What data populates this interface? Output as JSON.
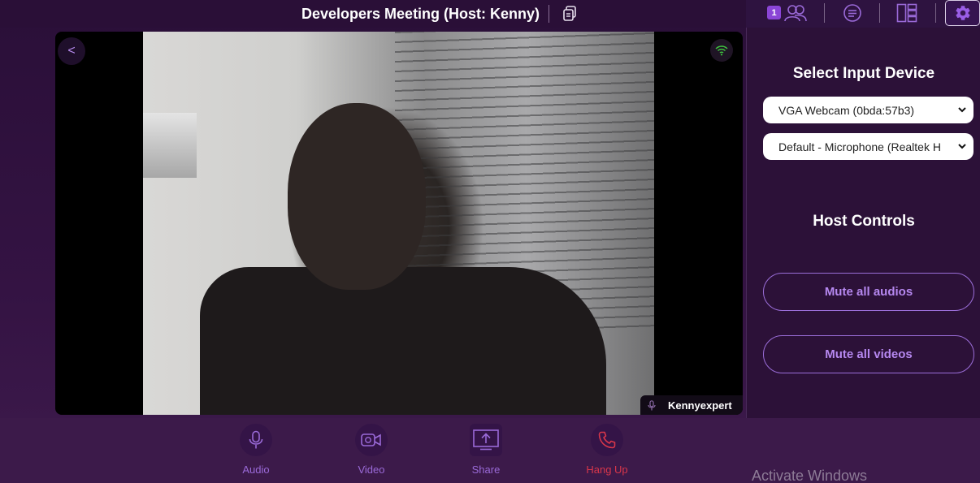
{
  "header": {
    "meeting_title": "Developers Meeting (Host: Kenny)",
    "participant_count": "1"
  },
  "video": {
    "back_label": "<",
    "participant_name": "Kennyexpert"
  },
  "settings": {
    "input_title": "Select Input Device",
    "camera_value": "VGA Webcam (0bda:57b3)",
    "mic_value": "Default - Microphone (Realtek H",
    "host_title": "Host Controls",
    "mute_audios_label": "Mute all audios",
    "mute_videos_label": "Mute all videos"
  },
  "controls": {
    "audio_label": "Audio",
    "video_label": "Video",
    "share_label": "Share",
    "hangup_label": "Hang Up"
  },
  "system": {
    "watermark": "Activate Windows"
  },
  "colors": {
    "accent": "#9a6ad8",
    "badge": "#8a45d6",
    "hangup": "#d8364a",
    "signal": "#3fc23f"
  },
  "icons": [
    "copy-icon",
    "participants-icon",
    "chat-icon",
    "layout-icon",
    "gear-icon",
    "signal-icon",
    "mic-icon",
    "video-icon",
    "share-icon",
    "phone-icon",
    "chevron-down-icon"
  ]
}
